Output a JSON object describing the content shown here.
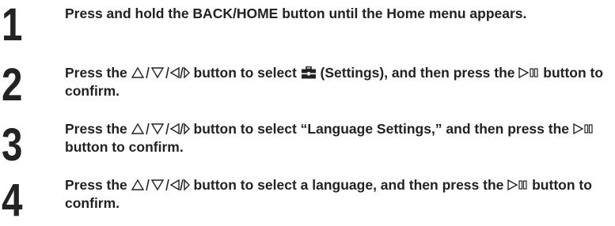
{
  "steps": [
    {
      "number": "1",
      "parts": [
        {
          "type": "text",
          "value": "Press and hold the BACK/HOME button until the Home menu appears."
        }
      ]
    },
    {
      "number": "2",
      "parts": [
        {
          "type": "text",
          "value": "Press the "
        },
        {
          "type": "icon",
          "icon": "up-down-left-right-arrows-icon"
        },
        {
          "type": "text",
          "value": " button to select "
        },
        {
          "type": "icon",
          "icon": "settings-toolbox-icon"
        },
        {
          "type": "text",
          "value": " (Settings), and then press the "
        },
        {
          "type": "icon",
          "icon": "play-pause-icon"
        },
        {
          "type": "text",
          "value": " button to confirm."
        }
      ]
    },
    {
      "number": "3",
      "parts": [
        {
          "type": "text",
          "value": "Press the "
        },
        {
          "type": "icon",
          "icon": "up-down-left-right-arrows-icon"
        },
        {
          "type": "text",
          "value": " button to select “Language Settings,” and then press the "
        },
        {
          "type": "icon",
          "icon": "play-pause-icon"
        },
        {
          "type": "text",
          "value": " button to confirm."
        }
      ]
    },
    {
      "number": "4",
      "parts": [
        {
          "type": "text",
          "value": "Press the "
        },
        {
          "type": "icon",
          "icon": "up-down-left-right-arrows-icon"
        },
        {
          "type": "text",
          "value": " button to select a language, and then press the "
        },
        {
          "type": "icon",
          "icon": "play-pause-icon"
        },
        {
          "type": "text",
          "value": " button to confirm."
        }
      ]
    }
  ],
  "colors": {
    "text": "#222222",
    "number": "#232323",
    "background": "#ffffff"
  }
}
